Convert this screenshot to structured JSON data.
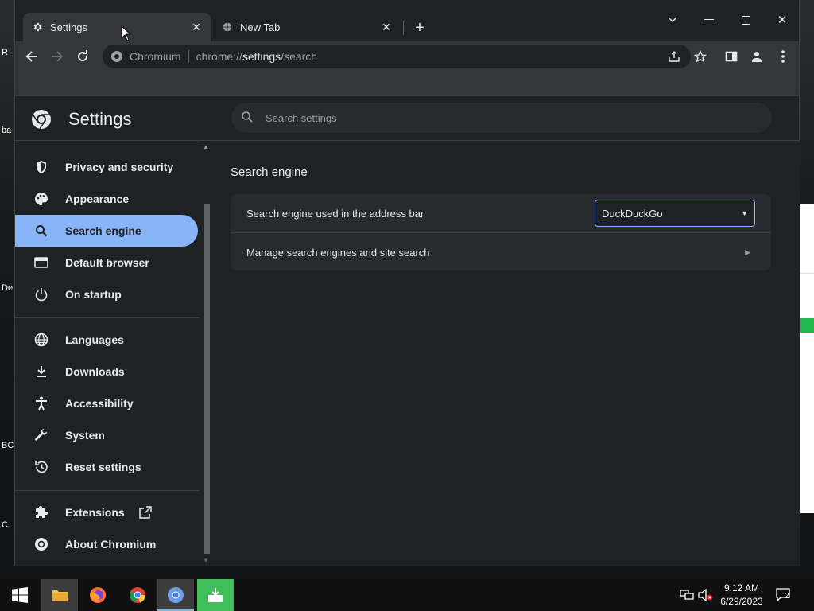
{
  "browser": {
    "tabs": [
      {
        "title": "Settings",
        "active": true
      },
      {
        "title": "New Tab",
        "active": false
      }
    ],
    "omnibox": {
      "origin_label": "Chromium",
      "url_scheme": "chrome://",
      "url_host": "settings",
      "url_path": "/search"
    }
  },
  "settings": {
    "title": "Settings",
    "search_placeholder": "Search settings",
    "sidebar": {
      "items": [
        {
          "label": "Privacy and security",
          "icon": "shield-icon"
        },
        {
          "label": "Appearance",
          "icon": "palette-icon"
        },
        {
          "label": "Search engine",
          "icon": "search-icon",
          "selected": true
        },
        {
          "label": "Default browser",
          "icon": "browser-icon"
        },
        {
          "label": "On startup",
          "icon": "power-icon"
        },
        {
          "label": "Languages",
          "icon": "globe-icon"
        },
        {
          "label": "Downloads",
          "icon": "download-icon"
        },
        {
          "label": "Accessibility",
          "icon": "accessibility-icon"
        },
        {
          "label": "System",
          "icon": "wrench-icon"
        },
        {
          "label": "Reset settings",
          "icon": "history-icon"
        },
        {
          "label": "Extensions",
          "icon": "puzzle-icon"
        },
        {
          "label": "About Chromium",
          "icon": "chromium-icon"
        }
      ]
    },
    "section": {
      "title": "Search engine",
      "rows": [
        {
          "label": "Search engine used in the address bar",
          "value": "DuckDuckGo"
        },
        {
          "label": "Manage search engines and site search"
        }
      ]
    }
  },
  "taskbar": {
    "time": "9:12 AM",
    "date": "6/29/2023",
    "notification_count": "2"
  },
  "desktop": {
    "labels": [
      "R",
      "ba",
      "De",
      "BC",
      "C"
    ]
  },
  "colors": {
    "accent": "#8ab4f8",
    "surface": "#292a2d",
    "background": "#202124"
  }
}
